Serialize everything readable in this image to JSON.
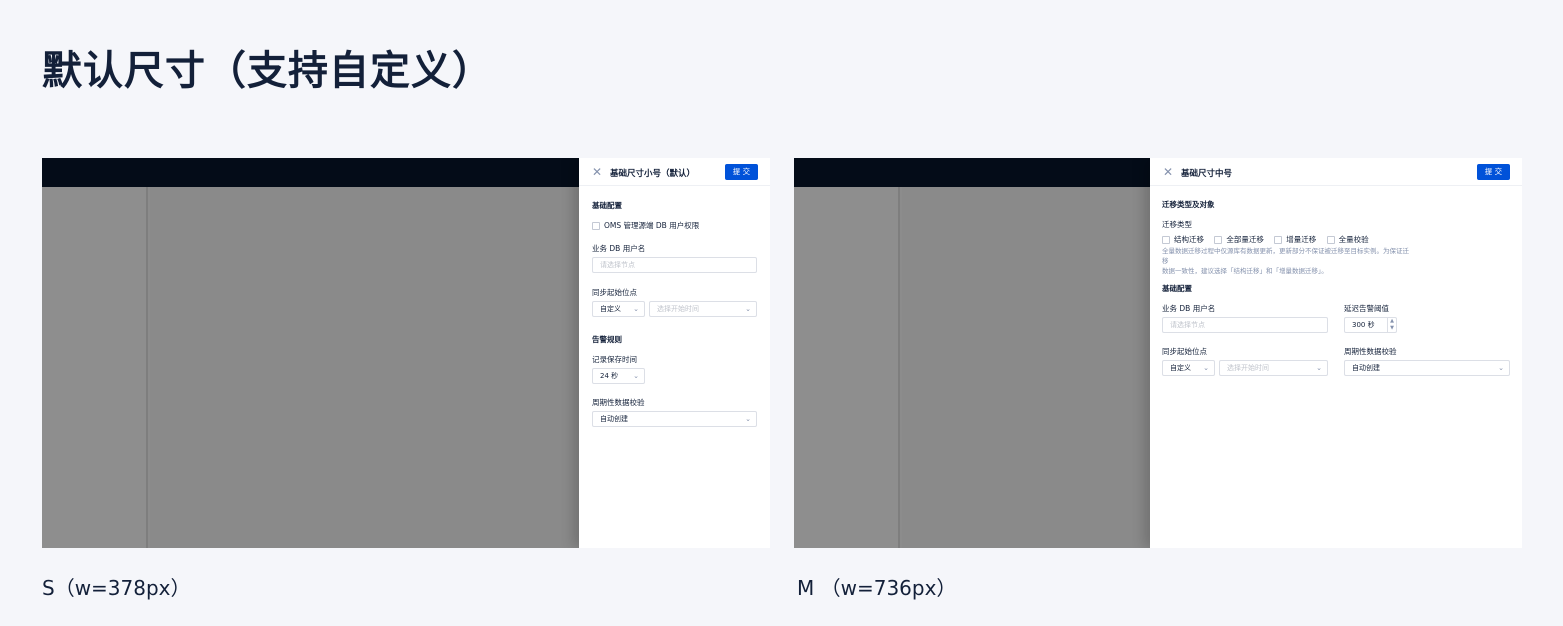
{
  "page": {
    "title": "默认尺寸（支持自定义）"
  },
  "small": {
    "caption": "S（w=378px）",
    "drawer": {
      "title": "基础尺寸小号（默认）",
      "submit_label": "提 交",
      "section_basic": "基础配置",
      "checkbox_label": "OMS 管理源端 DB 用户权限",
      "db_user_label": "业务 DB 用户名",
      "db_user_placeholder": "请选择节点",
      "sync_label": "同步起始位点",
      "sync_select_value": "自定义",
      "sync_time_placeholder": "选择开始时间",
      "section_alert": "告警规则",
      "record_label": "记录保存时间",
      "record_value": "24 秒",
      "check_label": "周期性数据校验",
      "check_value": "自动创建"
    }
  },
  "medium": {
    "caption": "M （w=736px）",
    "drawer": {
      "title": "基础尺寸中号",
      "submit_label": "提 交",
      "section_migrate": "迁移类型及对象",
      "migrate_type_label": "迁移类型",
      "migrate_options": [
        "结构迁移",
        "全部量迁移",
        "增量迁移",
        "全量校验"
      ],
      "hint_line1": "全量数据迁移过程中仅源库有数据更新，更新部分不保证被迁移至目标实例。为保证迁移",
      "hint_line2": "数据一致性，建议选择「结构迁移」和「增量数据迁移」。",
      "section_basic": "基础配置",
      "db_user_label": "业务 DB 用户名",
      "db_user_placeholder": "请选择节点",
      "delay_label": "延迟告警阈值",
      "delay_value": "300 秒",
      "sync_label": "同步起始位点",
      "sync_select_value": "自定义",
      "sync_time_placeholder": "选择开始时间",
      "check_label": "周期性数据校验",
      "check_value": "自动创建"
    }
  },
  "icons": {
    "close": "close-icon",
    "chevron": "chevron-down-icon",
    "stepper": "stepper-icon"
  },
  "colors": {
    "primary": "#0052d9",
    "text": "#132039",
    "topbar": "#040c18",
    "background": "#f5f6fa"
  }
}
